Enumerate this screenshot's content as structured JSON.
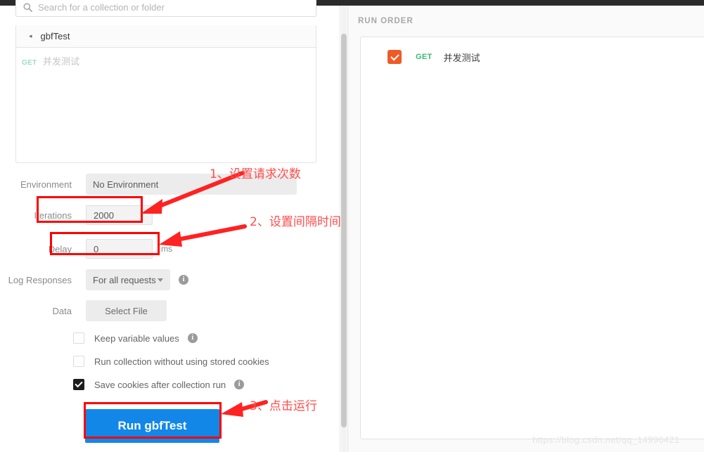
{
  "search": {
    "placeholder": "Search for a collection or folder",
    "icon": "search-icon"
  },
  "collection": {
    "name": "gbfTest",
    "caret": "◂",
    "requests": [
      {
        "method": "GET",
        "name": "并发测试"
      }
    ]
  },
  "form": {
    "environment": {
      "label": "Environment",
      "value": "No Environment"
    },
    "iterations": {
      "label": "Iterations",
      "value": "2000"
    },
    "delay": {
      "label": "Delay",
      "value": "0",
      "unit": "ms"
    },
    "log_responses": {
      "label": "Log Responses",
      "value": "For all requests",
      "info": "info-icon"
    },
    "data": {
      "label": "Data",
      "button": "Select File"
    },
    "checkboxes": [
      {
        "label": "Keep variable values",
        "checked": false,
        "info": true
      },
      {
        "label": "Run collection without using stored cookies",
        "checked": false,
        "info": false
      },
      {
        "label": "Save cookies after collection run",
        "checked": true,
        "info": true
      }
    ],
    "run_button": "Run gbfTest"
  },
  "run_order": {
    "title": "RUN ORDER",
    "items": [
      {
        "checked": true,
        "method": "GET",
        "name": "并发测试"
      }
    ]
  },
  "annotations": [
    {
      "text": "1、设置请求次数"
    },
    {
      "text": "2、设置间隔时间"
    },
    {
      "text": "3、点击运行"
    }
  ],
  "watermark": "https://blog.csdn.net/qq_14996421",
  "colors": {
    "annotation_red": "#ff0000",
    "annotation_text": "#ff4d4d",
    "run_button_blue": "#1287e8",
    "checkbox_orange": "#ef5b25",
    "method_green": "#3aba78"
  }
}
